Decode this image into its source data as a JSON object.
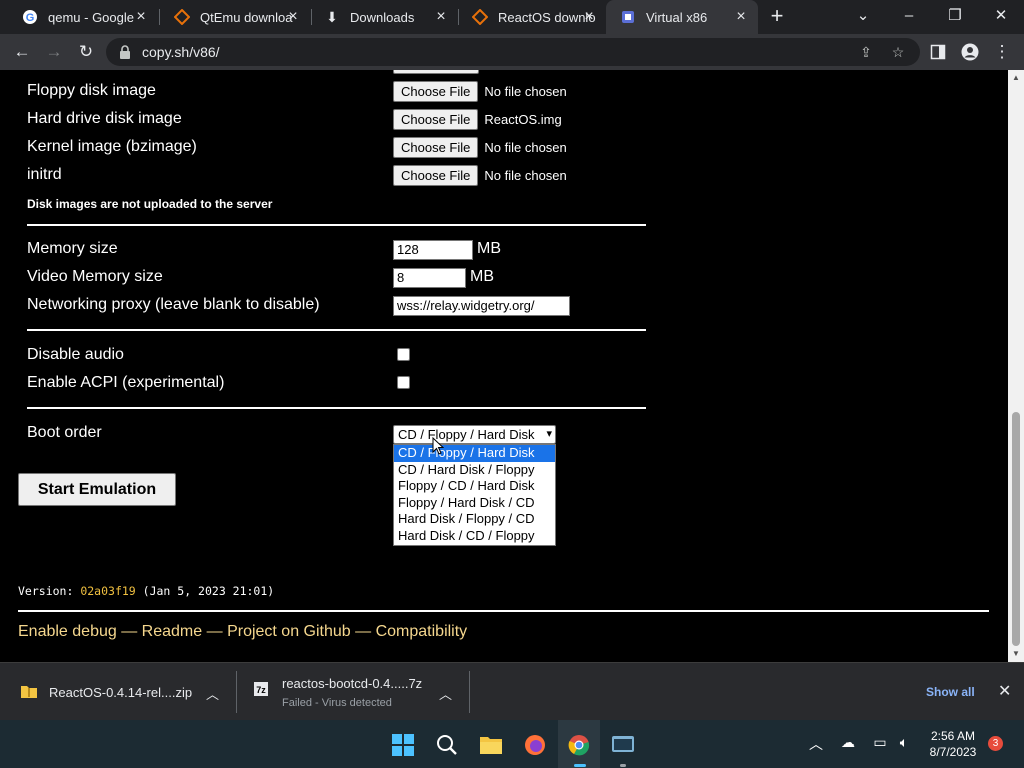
{
  "browser": {
    "tabs": [
      {
        "title": "qemu - Google",
        "icon": "google-icon"
      },
      {
        "title": "QtEmu downloa",
        "icon": "qtemu-icon"
      },
      {
        "title": "Downloads",
        "icon": "download-icon"
      },
      {
        "title": "ReactOS downlo",
        "icon": "reactos-icon"
      },
      {
        "title": "Virtual x86",
        "icon": "v86-icon"
      }
    ],
    "url": "copy.sh/v86/"
  },
  "settings": {
    "floppy_label": "Floppy disk image",
    "hdd_label": "Hard drive disk image",
    "kernel_label": "Kernel image (bzimage)",
    "initrd_label": "initrd",
    "choose_file_label": "Choose File",
    "floppy_file": "No file chosen",
    "hdd_file": "ReactOS.img",
    "kernel_file": "No file chosen",
    "initrd_file": "No file chosen",
    "upload_note": "Disk images are not uploaded to the server",
    "memory_label": "Memory size",
    "memory_value": "128",
    "video_memory_label": "Video Memory size",
    "video_memory_value": "8",
    "unit_mb": "MB",
    "proxy_label": "Networking proxy (leave blank to disable)",
    "proxy_value": "wss://relay.widgetry.org/",
    "disable_audio_label": "Disable audio",
    "acpi_label": "Enable ACPI (experimental)",
    "boot_order_label": "Boot order",
    "boot_order_selected": "CD / Floppy / Hard Disk",
    "boot_order_options": [
      "CD / Floppy / Hard Disk",
      "CD / Hard Disk / Floppy",
      "Floppy / CD / Hard Disk",
      "Floppy / Hard Disk / CD",
      "Hard Disk / Floppy / CD",
      "Hard Disk / CD / Floppy"
    ],
    "start_button": "Start Emulation"
  },
  "footer": {
    "version_prefix": "Version:",
    "version_hash": "02a03f19",
    "version_date": "(Jan 5, 2023 21:01)",
    "links": [
      "Enable debug",
      "Readme",
      "Project on Github",
      "Compatibility"
    ],
    "separator": "—"
  },
  "downloads": [
    {
      "name": "ReactOS-0.4.14-rel....zip",
      "status": ""
    },
    {
      "name": "reactos-bootcd-0.4.....7z",
      "status": "Failed - Virus detected"
    }
  ],
  "download_shelf": {
    "show_all": "Show all"
  },
  "taskbar": {
    "time": "2:56 AM",
    "date": "8/7/2023",
    "notification_count": "3"
  },
  "colors": {
    "link": "#f5d78e",
    "version_hash": "#f0c040",
    "selected_option": "#1a73e8"
  }
}
